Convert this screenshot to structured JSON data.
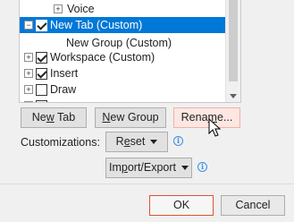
{
  "tree": {
    "voice_label": "Voice",
    "new_tab_label": "New Tab (Custom)",
    "new_group_label": "New Group (Custom)",
    "workspace_label": "Workspace (Custom)",
    "insert_label": "Insert",
    "draw_label": "Draw"
  },
  "buttons": {
    "new_tab_pre": "Ne",
    "new_tab_u": "w",
    "new_tab_post": " Tab",
    "new_group_pre": "",
    "new_group_u": "N",
    "new_group_post": "ew Group",
    "rename_pre": "Rena",
    "rename_u": "m",
    "rename_post": "e...",
    "reset_pre": "R",
    "reset_u": "e",
    "reset_post": "set",
    "import_pre": "Im",
    "import_u": "p",
    "import_post": "ort/Export",
    "ok_label": "OK",
    "cancel_label": "Cancel"
  },
  "customizations_label": "Customizations:",
  "colors": {
    "selection": "#0078d7",
    "hover": "#fde7e2",
    "primary_border": "#d9542c"
  }
}
